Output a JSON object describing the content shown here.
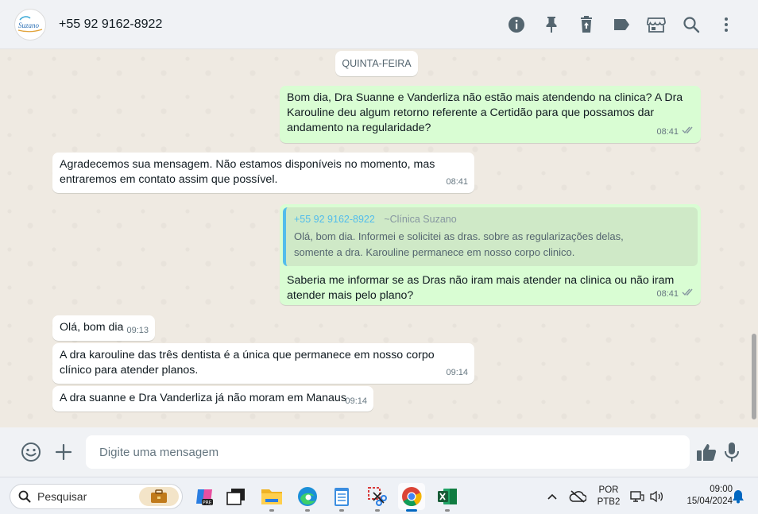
{
  "header": {
    "contact": "+55 92 9162-8922",
    "avatar_logo_text": "Suzano",
    "icons": [
      "info-icon",
      "pin-icon",
      "delete-icon",
      "label-icon",
      "store-icon",
      "search-icon",
      "more-icon"
    ]
  },
  "chat": {
    "day_divider": "QUINTA-FEIRA",
    "messages": [
      {
        "dir": "out",
        "text": "Bom dia, Dra Suanne e Vanderliza não estão mais atendendo na clinica? A Dra Karouline deu algum retorno referente a Certidão para que possamos dar andamento na regularidade?",
        "time": "08:41",
        "status": "read"
      },
      {
        "dir": "in",
        "text": "Agradecemos sua mensagem. Não estamos disponíveis no momento, mas entraremos em contato assim que possível.",
        "time": "08:41"
      },
      {
        "dir": "out",
        "quote": {
          "author": "+55 92 9162-8922",
          "alias": "~Clínica Suzano",
          "text_line1": "Olá, bom dia. Informei e solicitei as dras. sobre as regularizações delas,",
          "text_line2": "somente a dra. Karouline permanece em nosso corpo clinico."
        },
        "text": "Saberia me informar se as Dras não iram mais atender na clinica ou não iram atender mais pelo plano?",
        "time": "08:41",
        "status": "read"
      },
      {
        "dir": "in",
        "text": "Olá, bom dia",
        "time": "09:13"
      },
      {
        "dir": "in",
        "text": "A dra karouline das três dentista é a única que permanece em nosso corpo clínico para atender planos.",
        "time": "09:14"
      },
      {
        "dir": "in",
        "text": "A dra suanne e Dra Vanderliza já não moram em Manaus",
        "time": "09:14"
      }
    ]
  },
  "composer": {
    "placeholder": "Digite uma mensagem"
  },
  "taskbar": {
    "search_label": "Pesquisar",
    "apps": [
      "copilot-icon",
      "task-view-icon",
      "file-explorer-icon",
      "edge-icon",
      "notepad-icon",
      "snipping-tool-icon",
      "chrome-icon",
      "excel-icon"
    ],
    "lang_line1": "POR",
    "lang_line2": "PTB2",
    "time": "09:00",
    "date": "15/04/2024"
  },
  "colors": {
    "outgoing_bubble": "#d9fdd3",
    "incoming_bubble": "#ffffff",
    "chat_background": "#efeae2",
    "quote_accent": "#53bdeb"
  }
}
